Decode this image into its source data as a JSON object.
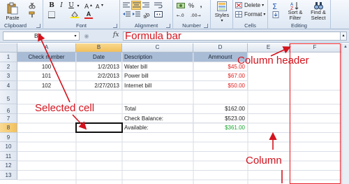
{
  "ribbon": {
    "clipboard": {
      "paste_label": "Paste",
      "group_label": "Clipboard"
    },
    "font": {
      "bold": "B",
      "italic": "I",
      "underline": "U",
      "font_color_letter": "A",
      "group_label": "Font"
    },
    "alignment": {
      "group_label": "Alignment"
    },
    "number": {
      "percent": "%",
      "comma": ",",
      "group_label": "Number"
    },
    "styles": {
      "label": "Styles"
    },
    "cells": {
      "delete_label": "Delete",
      "format_label": "Format",
      "group_label": "Cells"
    },
    "editing": {
      "sort_filter": "Sort &\nFilter",
      "find_select": "Find &\nSelect",
      "group_label": "Editing"
    }
  },
  "formula_bar": {
    "name_box": "B8",
    "fx_label": "fx",
    "annotation": "Formula bar"
  },
  "columns": [
    "A",
    "B",
    "C",
    "D",
    "E",
    "F"
  ],
  "selected_column": "B",
  "rows": [
    "1",
    "2",
    "3",
    "4",
    "5",
    "6",
    "7",
    "8",
    "9",
    "10",
    "11",
    "12",
    "13"
  ],
  "selected_row": "8",
  "table": {
    "headers": [
      "Check number",
      "Date",
      "Description",
      "Ammount"
    ],
    "rows": [
      {
        "check": "100",
        "date": "1/2/2013",
        "desc": "Water bill",
        "amount": "$45.00"
      },
      {
        "check": "101",
        "date": "2/2/2013",
        "desc": "Power bill",
        "amount": "$67.00"
      },
      {
        "check": "102",
        "date": "2/27/2013",
        "desc": "Internet bill",
        "amount": "$50.00"
      }
    ],
    "summary": [
      {
        "label": "Total",
        "value": "$162.00"
      },
      {
        "label": "Check Balance:",
        "value": "$523.00"
      },
      {
        "label": "Available:",
        "value": "$361.00"
      }
    ]
  },
  "annotations": {
    "column_header": "Column header",
    "selected_cell": "Selected cell",
    "column": "Column"
  },
  "colors": {
    "annotation": "#d3141e",
    "header_fill": "#a8bcd6",
    "negative": "#e11d1d",
    "positive": "#18a531"
  }
}
